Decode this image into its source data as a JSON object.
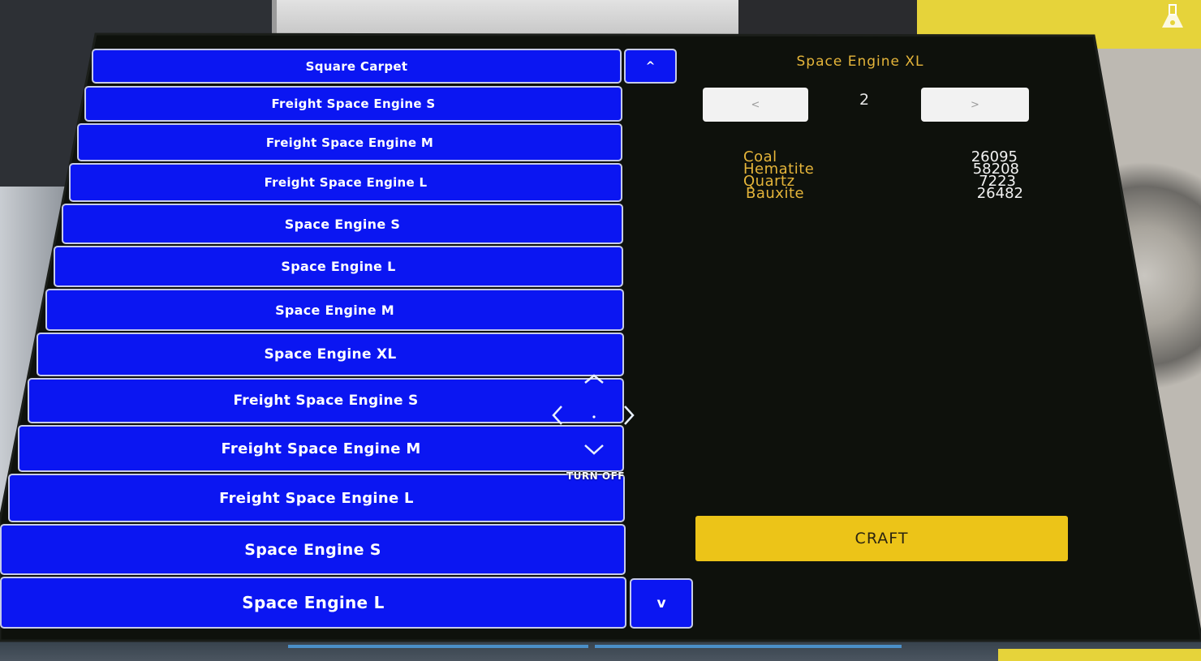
{
  "list": {
    "items": [
      "Square Carpet",
      "Freight Space Engine S",
      "Freight Space Engine M",
      "Freight Space Engine L",
      "Space Engine S",
      "Space Engine L",
      "Space Engine M",
      "Space Engine XL",
      "Freight Space Engine S",
      "Freight Space Engine M",
      "Freight Space Engine L",
      "Space Engine S",
      "Space Engine L"
    ],
    "scroll_up_label": "^",
    "scroll_down_label": "v"
  },
  "detail": {
    "title": "Space Engine XL",
    "prev_label": "<",
    "next_label": ">",
    "page": "2",
    "resources": [
      {
        "name": "Coal",
        "amount": "26095"
      },
      {
        "name": "Hematite",
        "amount": "58208"
      },
      {
        "name": "Quartz",
        "amount": "7223"
      },
      {
        "name": "Bauxite",
        "amount": "26482"
      }
    ],
    "craft_label": "CRAFT"
  },
  "controls": {
    "turn_off_label": "TURN OFF"
  },
  "colors": {
    "button_blue": "#0b16f2",
    "title_gold": "#e5b53a",
    "craft_yellow": "#ecc418",
    "screen_bg": "#0e110c"
  }
}
